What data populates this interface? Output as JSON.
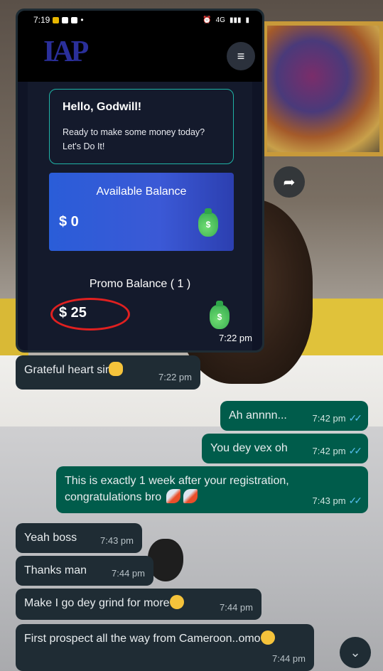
{
  "embedded_screenshot": {
    "status_bar": {
      "time": "7:19",
      "icons_left": [
        "notification-icons"
      ],
      "signal": "4G"
    },
    "app": {
      "logo_text": "IAP",
      "greeting_title": "Hello, Godwill!",
      "greeting_subtitle": "Ready to make some money today? Let's Do It!",
      "available_balance_label": "Available Balance",
      "available_balance_value": "$ 0",
      "promo_balance_label": "Promo Balance ( 1 )",
      "promo_balance_value": "$ 25"
    },
    "time": "7:22 pm"
  },
  "messages": [
    {
      "dir": "in",
      "text": "Grateful heart sir",
      "emoji": "raised-hands",
      "time": "7:22 pm"
    },
    {
      "dir": "out",
      "text": "Ah annnn...",
      "time": "7:42 pm",
      "read": true
    },
    {
      "dir": "out",
      "text": "You dey vex oh",
      "time": "7:42 pm",
      "read": true
    },
    {
      "dir": "out",
      "text_line1": "This is exactly 1 week after your registration,",
      "text_line2": "congratulations bro",
      "emoji": "rocket-rocket",
      "time": "7:43 pm",
      "read": true
    },
    {
      "dir": "in",
      "text": "Yeah boss",
      "time": "7:43 pm"
    },
    {
      "dir": "in",
      "text": "Thanks man",
      "time": "7:44 pm"
    },
    {
      "dir": "in",
      "text": "Make I go dey grind for more",
      "emoji": "grinning-sweat",
      "time": "7:44 pm"
    },
    {
      "dir": "in",
      "text": "First prospect all the way from Cameroon..omo",
      "emoji": "grinning-sweat",
      "time": "7:44 pm"
    }
  ],
  "colors": {
    "incoming": "#1f2c34",
    "outgoing": "#005c4b",
    "tick": "#53bdeb",
    "highlight_circle": "#e02020"
  }
}
